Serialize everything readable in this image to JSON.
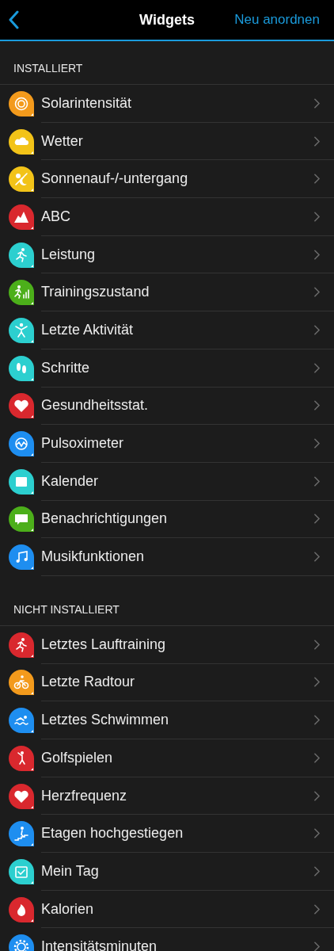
{
  "nav": {
    "title": "Widgets",
    "action": "Neu anordnen"
  },
  "sections": [
    {
      "title": "INSTALLIERT",
      "items": [
        {
          "label": "Solarintensität",
          "color": "#f39a1c"
        },
        {
          "label": "Wetter",
          "color": "#f2c318"
        },
        {
          "label": "Sonnenauf-/-untergang",
          "color": "#f2c318"
        },
        {
          "label": "ABC",
          "color": "#d9282e"
        },
        {
          "label": "Leistung",
          "color": "#2ccfcf"
        },
        {
          "label": "Trainingszustand",
          "color": "#4caf1a"
        },
        {
          "label": "Letzte Aktivität",
          "color": "#2ccfcf"
        },
        {
          "label": "Schritte",
          "color": "#2ccfcf"
        },
        {
          "label": "Gesundheitsstat.",
          "color": "#d9282e"
        },
        {
          "label": "Pulsoximeter",
          "color": "#1e8ef0"
        },
        {
          "label": "Kalender",
          "color": "#2ccfcf"
        },
        {
          "label": "Benachrichtigungen",
          "color": "#4caf1a"
        },
        {
          "label": "Musikfunktionen",
          "color": "#1e8ef0"
        }
      ]
    },
    {
      "title": "NICHT INSTALLIERT",
      "items": [
        {
          "label": "Letztes Lauftraining",
          "color": "#d9282e"
        },
        {
          "label": "Letzte Radtour",
          "color": "#f39a1c"
        },
        {
          "label": "Letztes Schwimmen",
          "color": "#1e8ef0"
        },
        {
          "label": "Golfspielen",
          "color": "#d9282e"
        },
        {
          "label": "Herzfrequenz",
          "color": "#d9282e"
        },
        {
          "label": "Etagen hochgestiegen",
          "color": "#1e8ef0"
        },
        {
          "label": "Mein Tag",
          "color": "#2ccfcf"
        },
        {
          "label": "Kalorien",
          "color": "#d9282e"
        },
        {
          "label": "Intensitätsminuten",
          "color": "#1e8ef0"
        }
      ]
    }
  ]
}
